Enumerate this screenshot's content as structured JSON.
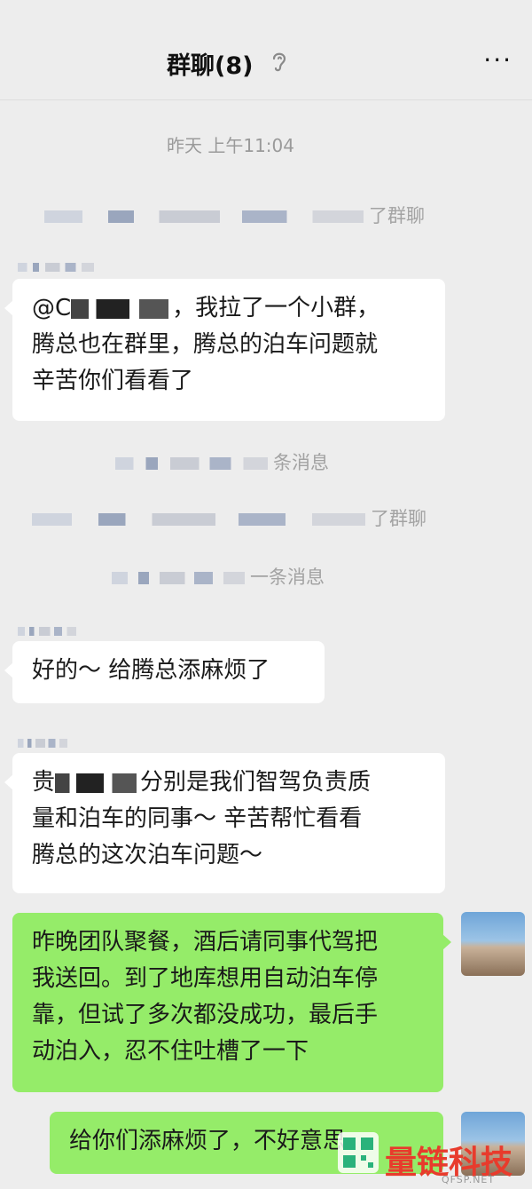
{
  "header": {
    "title": "群聊(8)",
    "more_label": "···"
  },
  "timestamp": "昨天 上午11:04",
  "system_messages": [
    {
      "suffix": "了群聊"
    },
    {
      "suffix": "条消息"
    },
    {
      "suffix": "了群聊"
    },
    {
      "suffix": "一条消息"
    }
  ],
  "messages": [
    {
      "side": "left",
      "lines": [
        "@C",
        "，我拉了一个小群，",
        "腾总也在群里，腾总的泊车问题就",
        "辛苦你们看看了"
      ]
    },
    {
      "side": "left",
      "lines": [
        "好的～ 给腾总添麻烦了"
      ]
    },
    {
      "side": "left",
      "lines": [
        "贵",
        "分别是我们智驾负责质",
        "量和泊车的同事～ 辛苦帮忙看看",
        "腾总的这次泊车问题～"
      ]
    },
    {
      "side": "right",
      "lines": [
        "昨晚团队聚餐，酒后请同事代驾把",
        "我送回。到了地库想用自动泊车停",
        "靠，但试了多次都没成功，最后手",
        "动泊入，忍不住吐槽了一下"
      ]
    },
    {
      "side": "right",
      "lines": [
        "给你们添麻烦了，不好意思"
      ]
    }
  ],
  "watermark": {
    "brand": "量链科技",
    "url": "QFSP.NET",
    "brand_color": "#e83b2c"
  },
  "colors": {
    "background": "#ededed",
    "self_bubble": "#95ec69",
    "other_bubble": "#ffffff"
  }
}
